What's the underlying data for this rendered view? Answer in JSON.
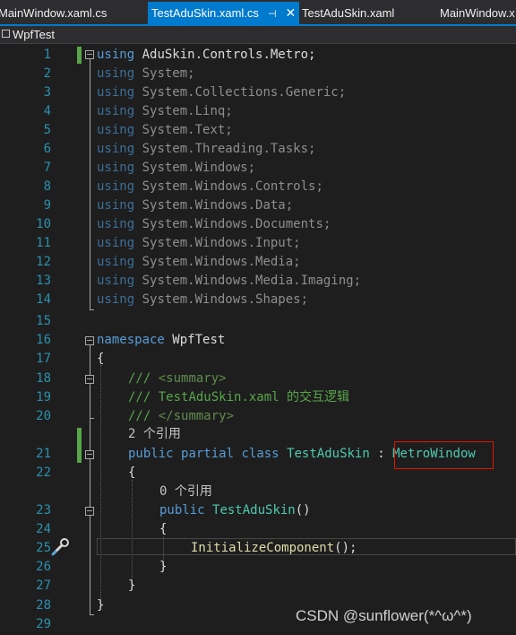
{
  "tabs": [
    {
      "label": "MainWindow.xaml.cs"
    },
    {
      "label": "TestAduSkin.xaml.cs",
      "active": true
    },
    {
      "label": "TestAduSkin.xaml"
    },
    {
      "label": "MainWindow.x"
    }
  ],
  "navbar": {
    "project": "WpfTest"
  },
  "code": {
    "using_kw": "using",
    "usings": [
      "AduSkin.Controls.Metro;",
      "System;",
      "System.Collections.Generic;",
      "System.Linq;",
      "System.Text;",
      "System.Threading.Tasks;",
      "System.Windows;",
      "System.Windows.Controls;",
      "System.Windows.Data;",
      "System.Windows.Documents;",
      "System.Windows.Input;",
      "System.Windows.Media;",
      "System.Windows.Media.Imaging;",
      "System.Windows.Shapes;"
    ],
    "namespace_kw": "namespace",
    "namespace_name": "WpfTest",
    "open_brace": "{",
    "close_brace": "}",
    "comment_slashes": "///",
    "summary_open": "<summary>",
    "summary_text": "TestAduSkin.xaml 的交互逻辑",
    "summary_close": "</summary>",
    "class_refs": "2 个引用",
    "public_kw": "public",
    "partial_kw": "partial",
    "class_kw": "class",
    "class_name": "TestAduSkin",
    "colon": ":",
    "base_class": "MetroWindow",
    "ctor_refs": "0 个引用",
    "ctor_name": "TestAduSkin",
    "ctor_parens": "()",
    "init_call": "InitializeComponent",
    "init_tail": "();"
  },
  "line_numbers": [
    "1",
    "2",
    "3",
    "4",
    "5",
    "6",
    "7",
    "8",
    "9",
    "10",
    "11",
    "12",
    "13",
    "14",
    "15",
    "16",
    "17",
    "18",
    "19",
    "20",
    "21",
    "22",
    "23",
    "24",
    "25",
    "26",
    "27",
    "28",
    "29"
  ],
  "watermark": "CSDN @sunflower(*^ω^*)",
  "colors": {
    "keyword": "#569cd6",
    "type": "#4ec9b0",
    "comment": "#57a64a",
    "line_number": "#2b91af",
    "highlight_border": "#e51400",
    "active_tab": "#007acc"
  }
}
